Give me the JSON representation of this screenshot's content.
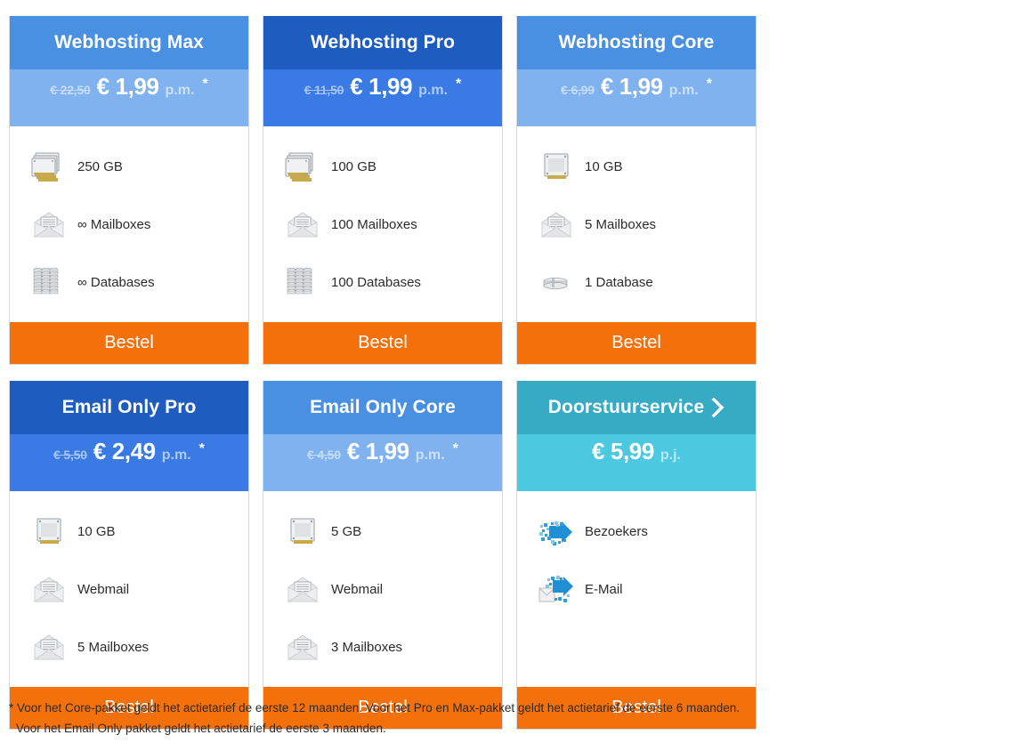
{
  "colors": {
    "orange": "#f4700a",
    "blue_light_header": "#4a90e2",
    "blue_light_price": "#7fb2ee",
    "blue_dark_header": "#1f5cbf",
    "blue_dark_price": "#3a7ae4",
    "teal_header": "#38abc4",
    "teal_price": "#4cc8e0",
    "card_border": "#d4d9de",
    "text": "#2b2b2b"
  },
  "order_label": "Bestel",
  "cards": [
    {
      "title": "Webhosting Max",
      "theme": "blue-light",
      "old_price": "€ 22,50",
      "new_price": "€ 1,99",
      "per": "p.m.",
      "asterisk": "*",
      "has_chevron": false,
      "features": [
        {
          "icon": "disk-stack-icon",
          "label": "250 GB"
        },
        {
          "icon": "envelope-icon",
          "label": "∞ Mailboxes"
        },
        {
          "icon": "database-stack-icon",
          "label": "∞ Databases"
        }
      ]
    },
    {
      "title": "Webhosting Pro",
      "theme": "blue-dark",
      "old_price": "€ 11,50",
      "new_price": "€ 1,99",
      "per": "p.m.",
      "asterisk": "*",
      "has_chevron": false,
      "features": [
        {
          "icon": "disk-stack-icon",
          "label": "100 GB"
        },
        {
          "icon": "envelope-icon",
          "label": "100 Mailboxes"
        },
        {
          "icon": "database-stack-icon",
          "label": "100 Databases"
        }
      ]
    },
    {
      "title": "Webhosting Core",
      "theme": "blue-light",
      "old_price": "€ 6,99",
      "new_price": "€ 1,99",
      "per": "p.m.",
      "asterisk": "*",
      "has_chevron": false,
      "features": [
        {
          "icon": "disk-single-icon",
          "label": "10 GB"
        },
        {
          "icon": "envelope-icon",
          "label": "5 Mailboxes"
        },
        {
          "icon": "database-single-icon",
          "label": "1 Database"
        }
      ]
    },
    {
      "title": "Email Only Pro",
      "theme": "blue-dark",
      "old_price": "€ 5,50",
      "new_price": "€ 2,49",
      "per": "p.m.",
      "asterisk": "*",
      "has_chevron": false,
      "features": [
        {
          "icon": "disk-single-icon",
          "label": "10 GB"
        },
        {
          "icon": "envelope-icon",
          "label": "Webmail"
        },
        {
          "icon": "envelope-icon",
          "label": "5 Mailboxes"
        }
      ]
    },
    {
      "title": "Email Only Core",
      "theme": "blue-light",
      "old_price": "€ 4,50",
      "new_price": "€ 1,99",
      "per": "p.m.",
      "asterisk": "*",
      "has_chevron": false,
      "features": [
        {
          "icon": "disk-single-icon",
          "label": "5 GB"
        },
        {
          "icon": "envelope-icon",
          "label": "Webmail"
        },
        {
          "icon": "envelope-icon",
          "label": "3 Mailboxes"
        }
      ]
    },
    {
      "title": "Doorstuurservice",
      "theme": "teal",
      "old_price": "",
      "new_price": "€ 5,99",
      "per": "p.j.",
      "asterisk": "",
      "has_chevron": true,
      "features": [
        {
          "icon": "forward-arrow-icon",
          "label": "Bezoekers"
        },
        {
          "icon": "mail-forward-icon",
          "label": "E-Mail"
        }
      ]
    }
  ],
  "footnote": {
    "line1": "* Voor het Core-pakket geldt het actietarief de eerste 12 maanden. Voor het Pro en Max-pakket geldt het actietarief de eerste 6 maanden.",
    "line2": "Voor het Email Only pakket geldt het actietarief de eerste 3 maanden."
  }
}
